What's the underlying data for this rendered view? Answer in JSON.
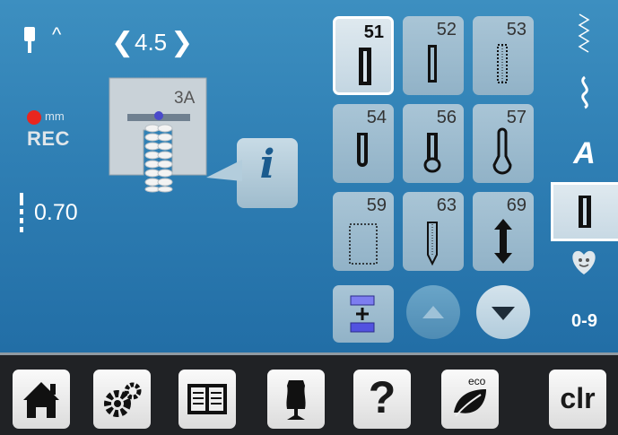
{
  "left_panel": {
    "needle_position_label": "^",
    "stitch_width": {
      "value": "4.5",
      "dec_label": "❮",
      "inc_label": "❯"
    },
    "rec": {
      "unit": "mm",
      "label": "REC"
    },
    "stitch_length": "0.70",
    "presser_foot": "3A"
  },
  "stitch_grid": {
    "items": [
      {
        "number": "51",
        "selected": true
      },
      {
        "number": "52",
        "selected": false
      },
      {
        "number": "53",
        "selected": false
      },
      {
        "number": "54",
        "selected": false
      },
      {
        "number": "56",
        "selected": false
      },
      {
        "number": "57",
        "selected": false
      },
      {
        "number": "59",
        "selected": false
      },
      {
        "number": "63",
        "selected": false
      },
      {
        "number": "69",
        "selected": false
      }
    ]
  },
  "categories": [
    {
      "name": "practical-stitches",
      "icon": "zigzag-stitch-icon"
    },
    {
      "name": "decorative-stitches",
      "icon": "decorative-stitch-icon"
    },
    {
      "name": "alphabets",
      "label": "A"
    },
    {
      "name": "buttonholes",
      "icon": "buttonhole-icon",
      "selected": true
    },
    {
      "name": "personal-program",
      "icon": "heart-icon"
    },
    {
      "name": "numbers",
      "label": "0-9"
    }
  ],
  "bottom_bar": {
    "help_label": "?",
    "eco_label": "eco",
    "clear_label": "clr"
  },
  "colors": {
    "screen_top": "#3d8fc0",
    "screen_bottom": "#226ea6",
    "rec_dot": "#e8261f",
    "tile": "#9fbccd",
    "bottom_bar": "#202225"
  }
}
